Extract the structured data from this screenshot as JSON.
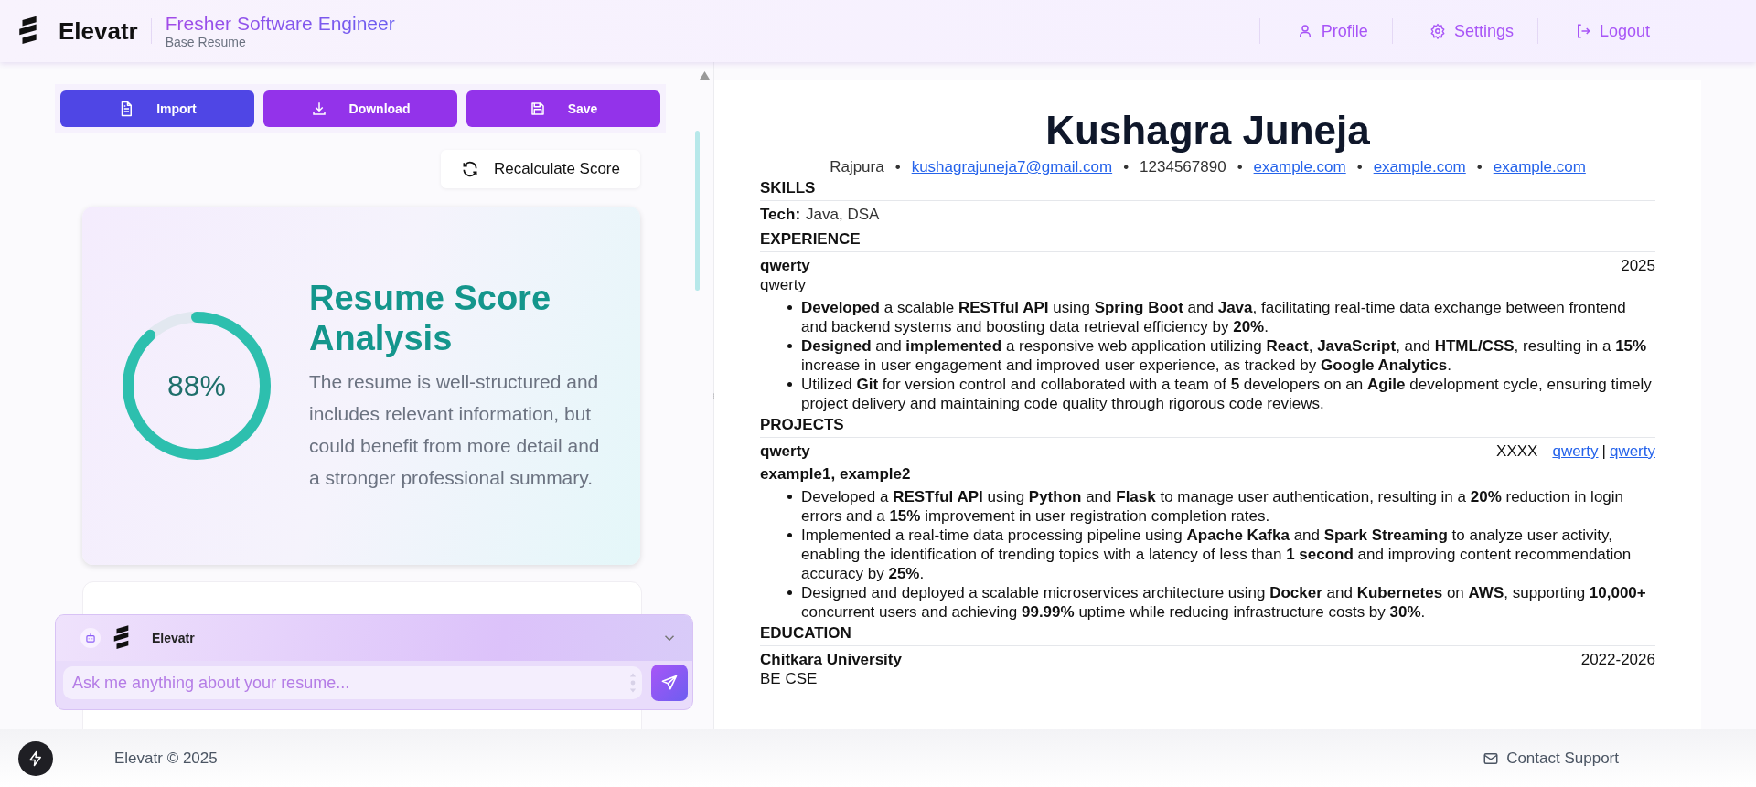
{
  "header": {
    "logo": "Elevatr",
    "title": "Fresher Software Engineer",
    "subtitle": "Base Resume",
    "nav": [
      {
        "kind": "profile",
        "label": "Profile"
      },
      {
        "kind": "settings",
        "label": "Settings"
      },
      {
        "kind": "logout",
        "label": "Logout"
      }
    ]
  },
  "toolbar": [
    {
      "kind": "import",
      "label": "Import"
    },
    {
      "kind": "download",
      "label": "Download"
    },
    {
      "kind": "save",
      "label": "Save"
    }
  ],
  "recalculate": "Recalculate Score",
  "score": {
    "value": "88%",
    "level": 0.88,
    "title": "Resume Score Analysis",
    "text": "The resume is well-structured and includes relevant information, but could benefit from more detail and a stronger professional summary."
  },
  "chat": {
    "name": "Elevatr",
    "placeholder": "Ask me anything about your resume..."
  },
  "resume": {
    "name": "Kushagra Juneja",
    "contacts": [
      {
        "kind": "text",
        "text": "Rajpura"
      },
      {
        "kind": "separator",
        "text": "•"
      },
      {
        "kind": "link",
        "text": "kushagrajuneja7@gmail.com"
      },
      {
        "kind": "separator",
        "text": "•"
      },
      {
        "kind": "text",
        "text": "1234567890"
      },
      {
        "kind": "separator",
        "text": "•"
      },
      {
        "kind": "link",
        "text": "example.com"
      },
      {
        "kind": "separator",
        "text": "•"
      },
      {
        "kind": "link",
        "text": "example.com"
      },
      {
        "kind": "separator",
        "text": "•"
      },
      {
        "kind": "link",
        "text": "example.com"
      }
    ],
    "sections": [
      {
        "heading": "SKILLS",
        "kind": "skills",
        "skills": [
          {
            "label": "Tech:",
            "value": "Java, DSA"
          }
        ]
      },
      {
        "heading": "EXPERIENCE",
        "kind": "entries",
        "entries": [
          {
            "kind": "job",
            "title": "qwerty",
            "date": "2025",
            "subtitle": "qwerty",
            "bullets": [
              "**Developed** a scalable **RESTful API** using **Spring Boot** and **Java**, facilitating real-time data exchange between frontend and backend systems and boosting data retrieval efficiency by **20%**.",
              "**Designed** and **implemented** a responsive web application utilizing **React**, **JavaScript**, and **HTML/CSS**, resulting in a **15%** increase in user engagement and improved user experience, as tracked by **Google Analytics**.",
              "Utilized **Git** for version control and collaborated with a team of **5** developers on an **Agile** development cycle, ensuring timely project delivery and maintaining code quality through rigorous code reviews."
            ]
          }
        ]
      },
      {
        "heading": "PROJECTS",
        "kind": "entries",
        "entries": [
          {
            "kind": "project",
            "title": "qwerty",
            "date": "XXXX",
            "links": [
              "qwerty",
              "|",
              "qwerty"
            ],
            "subtitle": "example1, example2",
            "bullets": [
              "Developed a **RESTful API** using **Python** and **Flask** to manage user authentication, resulting in a **20%** reduction in login errors and a **15%** improvement in user registration completion rates.",
              "Implemented a real-time data processing pipeline using **Apache Kafka** and **Spark Streaming** to analyze user activity, enabling the identification of trending topics with a latency of less than **1 second** and improving content recommendation accuracy by **25%**.",
              "Designed and deployed a scalable microservices architecture using **Docker** and **Kubernetes** on **AWS**, supporting **10,000+** concurrent users and achieving **99.99%** uptime while reducing infrastructure costs by **30%**."
            ]
          }
        ]
      },
      {
        "heading": "EDUCATION",
        "kind": "entries",
        "entries": [
          {
            "kind": "job",
            "title": "Chitkara University",
            "date": "2022-2026",
            "subtitle": "BE CSE"
          }
        ]
      }
    ]
  },
  "footer": {
    "copyright": "Elevatr © 2025",
    "contact": "Contact Support"
  }
}
